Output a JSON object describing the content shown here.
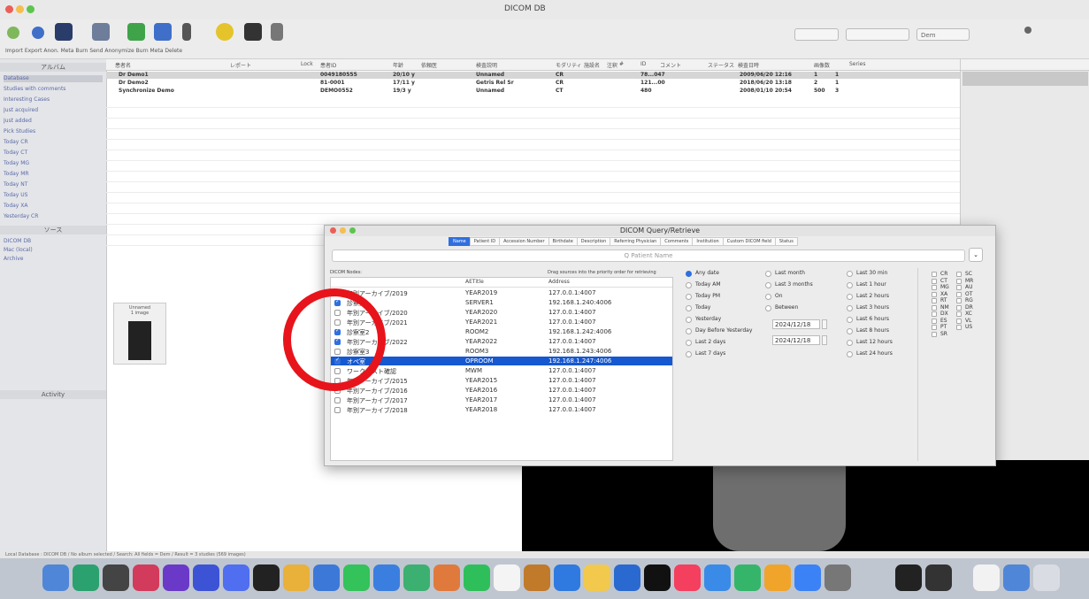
{
  "window": {
    "title": "DICOM DB"
  },
  "toolbar": {
    "labels": "Import  Export  Anon.  Meta  Burn  Send  Anonymize  Burn  Meta  Delete",
    "field1": "",
    "field2": "",
    "field3": "Dem"
  },
  "list_rows": [
    {
      "name": "Dr Demo1",
      "id": "0049180555",
      "age": "20/10 y",
      "desc": "Unnamed",
      "mod": "CR",
      "count": "78...047",
      "date": "2009/06/20 12:16",
      "n1": "1",
      "n2": "1"
    },
    {
      "name": "Dr Demo2",
      "id": "81-0001",
      "age": "17/11 y",
      "desc": "Getris Rel Sr",
      "mod": "CR",
      "count": "121...00",
      "date": "2018/06/20 13:18",
      "n1": "2",
      "n2": "1"
    },
    {
      "name": "Synchronize Demo",
      "id": "DEMO0552",
      "age": "19/3 y",
      "desc": "Unnamed",
      "mod": "CT",
      "count": "480",
      "date": "2008/01/10 20:54",
      "n1": "500",
      "n2": "3"
    }
  ],
  "sidebar": {
    "items": [
      "Database",
      "Studies with comments",
      "Interesting Cases",
      "Just acquired",
      "Just added",
      "Pick Studies",
      "Today CR",
      "Today CT",
      "Today MG",
      "Today MR",
      "Today NT",
      "Today US",
      "Today XA",
      "Yesterday CR"
    ],
    "section2": "ソース",
    "sources": [
      "DICOM DB",
      "Mac (local)",
      "Archive"
    ],
    "section3": "Activity"
  },
  "thumb": {
    "line1": "Unnamed",
    "line2": "1 image"
  },
  "dialog": {
    "title": "DICOM Query/Retrieve",
    "tabs": [
      {
        "label": "Name",
        "active": true
      },
      {
        "label": "Patient ID",
        "active": false
      },
      {
        "label": "Accession Number",
        "active": false
      },
      {
        "label": "Birthdate",
        "active": false
      },
      {
        "label": "Description",
        "active": false
      },
      {
        "label": "Referring Physician",
        "active": false
      },
      {
        "label": "Comments",
        "active": false
      },
      {
        "label": "Institution",
        "active": false
      },
      {
        "label": "Custom DICOM field",
        "active": false
      },
      {
        "label": "Status",
        "active": false
      }
    ],
    "search_placeholder": "Q  Patient Name",
    "nodes_label": "DICOM Nodes:",
    "drag_hint": "Drag sources into the priority order for retrieving",
    "table_headers": {
      "aetitle": "AETitle",
      "address": "Address"
    },
    "nodes": [
      {
        "name": "年別アーカイブ/2019",
        "aet": "YEAR2019",
        "addr": "127.0.0.1:4007",
        "checked": false,
        "selected": false
      },
      {
        "name": "診察室1",
        "aet": "SERVER1",
        "addr": "192.168.1.240:4006",
        "checked": true,
        "selected": false
      },
      {
        "name": "年別アーカイブ/2020",
        "aet": "YEAR2020",
        "addr": "127.0.0.1:4007",
        "checked": false,
        "selected": false
      },
      {
        "name": "年別アーカイブ/2021",
        "aet": "YEAR2021",
        "addr": "127.0.0.1:4007",
        "checked": false,
        "selected": false
      },
      {
        "name": "診察室2",
        "aet": "ROOM2",
        "addr": "192.168.1.242:4006",
        "checked": true,
        "selected": false
      },
      {
        "name": "年別アーカイブ/2022",
        "aet": "YEAR2022",
        "addr": "127.0.0.1:4007",
        "checked": true,
        "selected": false
      },
      {
        "name": "診察室3",
        "aet": "ROOM3",
        "addr": "192.168.1.243:4006",
        "checked": false,
        "selected": false
      },
      {
        "name": "オペ室",
        "aet": "OPROOM",
        "addr": "192.168.1.247:4006",
        "checked": true,
        "selected": true
      },
      {
        "name": "ワークリスト確認",
        "aet": "MWM",
        "addr": "127.0.0.1:4007",
        "checked": false,
        "selected": false
      },
      {
        "name": "年別アーカイブ/2015",
        "aet": "YEAR2015",
        "addr": "127.0.0.1:4007",
        "checked": false,
        "selected": false
      },
      {
        "name": "年別アーカイブ/2016",
        "aet": "YEAR2016",
        "addr": "127.0.0.1:4007",
        "checked": false,
        "selected": false
      },
      {
        "name": "年別アーカイブ/2017",
        "aet": "YEAR2017",
        "addr": "127.0.0.1:4007",
        "checked": false,
        "selected": false
      },
      {
        "name": "年別アーカイブ/2018",
        "aet": "YEAR2018",
        "addr": "127.0.0.1:4007",
        "checked": false,
        "selected": false
      }
    ],
    "date_col1": [
      "Any date",
      "Today AM",
      "Today PM",
      "Today",
      "Yesterday",
      "Day Before Yesterday",
      "Last 2 days",
      "Last 7 days"
    ],
    "date_col2": [
      "Last month",
      "Last 3 months",
      "On",
      "Between"
    ],
    "date_col3": [
      "Last 30 min",
      "Last 1 hour",
      "Last 2 hours",
      "Last 3 hours",
      "Last 6 hours",
      "Last 8 hours",
      "Last 12 hours",
      "Last 24 hours"
    ],
    "date_from": "2024/12/18",
    "date_to": "2024/12/18",
    "modalities_col1": [
      "CR",
      "CT",
      "MG",
      "XA",
      "RT",
      "NM",
      "DX",
      "ES",
      "PT",
      "SR"
    ],
    "modalities_col2": [
      "SC",
      "MR",
      "AU",
      "OT",
      "RG",
      "DR",
      "XC",
      "VL",
      "US"
    ]
  },
  "statusbar": {
    "text": "Local Database : DICOM DB / No album selected / Search: All fields = Dem / Result = 3 studies (569 images)"
  },
  "colors": {
    "accent": "#2f6fe0",
    "selection": "#1558d0",
    "annotation": "#e8141b"
  }
}
